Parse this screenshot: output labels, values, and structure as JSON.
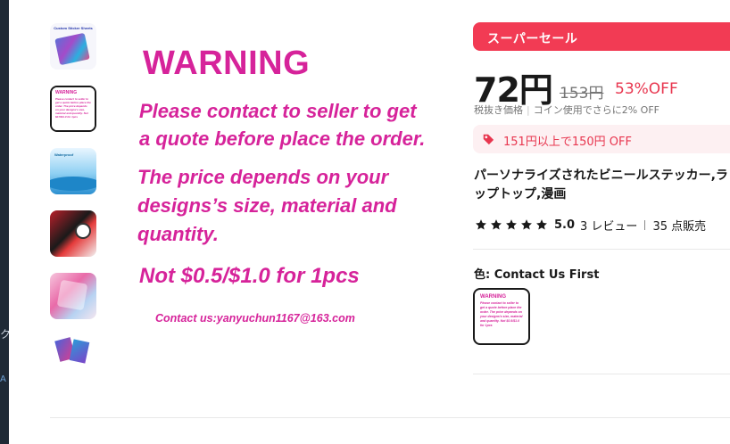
{
  "background_app": {
    "edge_glyph": "ク",
    "edge_glyph2": "A"
  },
  "gallery": {
    "thumb1": {
      "title_text": "Custom Sticker Sheets"
    },
    "thumb2": {
      "warning": "WARNING",
      "lines": "Please contact to seller to get a quote before place the order. The price depends on your designs's size, material and quantity. Not $0.5/$1.0 for 1pcs"
    },
    "thumb3": {
      "label": "Waterproof"
    },
    "main_image": {
      "warning": "WARNING",
      "line1": "Please contact to seller to get",
      "line2": "a quote before place the order.",
      "line3": "The price depends on your",
      "line4": "designs’s size, material and",
      "line5": "quantity.",
      "line6": "Not $0.5/$1.0 for 1pcs",
      "contact": "Contact us:yanyuchun1167@163.com"
    }
  },
  "product": {
    "sale_label": "スーパーセール",
    "price": "72円",
    "original_price": "153円",
    "discount": "53%OFF",
    "tax_note": "税抜き価格",
    "coin_note": "コイン使用でさらに2% OFF",
    "coupon": "151円以上で150円 OFF",
    "title": "パーソナライズされたビニールステッカー,ラップトップ,漫画",
    "rating": {
      "score": "5.0",
      "reviews": "3 レビュー",
      "sold": "35 点販売",
      "stars": 5
    },
    "color": {
      "label": "色: Contact Us First",
      "swatch_warning": "WARNING",
      "swatch_text": "Please contact to seller to get a quote before place the order. The price depends on your designs's size, material and quantity. Not $0.5/$1.0 for 1pcs"
    }
  },
  "colors": {
    "sale_red": "#f23b54",
    "magenta_text": "#d6239a",
    "discount_red": "#e8364f",
    "coupon_bg": "#fdf0f2"
  }
}
